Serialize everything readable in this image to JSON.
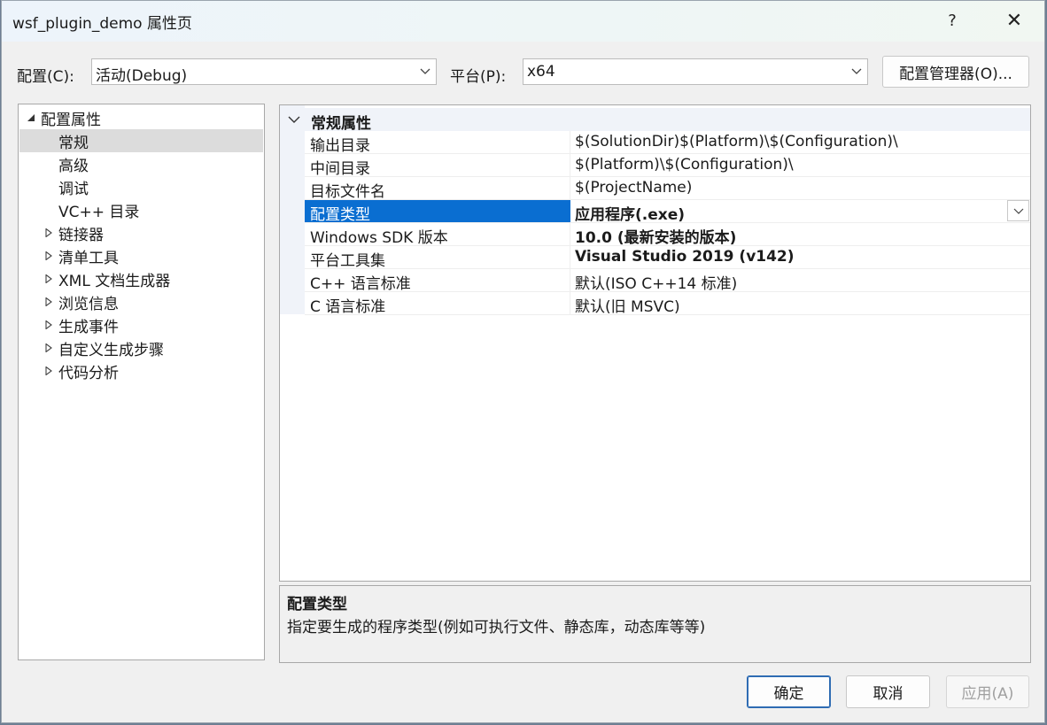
{
  "window": {
    "title": "wsf_plugin_demo 属性页"
  },
  "titlebar": {
    "help_glyph": "?",
    "close_glyph": "✕"
  },
  "config": {
    "label": "配置(C):",
    "value": "活动(Debug)",
    "platform_label": "平台(P):",
    "platform_value": "x64",
    "manager_button": "配置管理器(O)..."
  },
  "tree": {
    "root": "配置属性",
    "children": [
      "常规",
      "高级",
      "调试",
      "VC++ 目录"
    ],
    "groups": [
      "链接器",
      "清单工具",
      "XML 文档生成器",
      "浏览信息",
      "生成事件",
      "自定义生成步骤",
      "代码分析"
    ],
    "selected": "常规"
  },
  "grid": {
    "category": "常规属性",
    "rows": [
      {
        "name": "输出目录",
        "value": "$(SolutionDir)$(Platform)\\$(Configuration)\\"
      },
      {
        "name": "中间目录",
        "value": "$(Platform)\\$(Configuration)\\"
      },
      {
        "name": "目标文件名",
        "value": "$(ProjectName)"
      },
      {
        "name": "配置类型",
        "value": "应用程序(.exe)"
      },
      {
        "name": "Windows SDK 版本",
        "value": "10.0 (最新安装的版本)"
      },
      {
        "name": "平台工具集",
        "value": "Visual Studio 2019 (v142)"
      },
      {
        "name": "C++ 语言标准",
        "value": "默认(ISO C++14 标准)"
      },
      {
        "name": "C 语言标准",
        "value": "默认(旧 MSVC)"
      }
    ],
    "selected_row": "配置类型"
  },
  "description": {
    "title": "配置类型",
    "text": "指定要生成的程序类型(例如可执行文件、静态库，动态库等等)"
  },
  "buttons": {
    "ok": "确定",
    "cancel": "取消",
    "apply": "应用(A)"
  },
  "colors": {
    "selection": "#0a6ed1",
    "tree_selection": "#dcdcdc",
    "margin": "#f0f3f9"
  }
}
